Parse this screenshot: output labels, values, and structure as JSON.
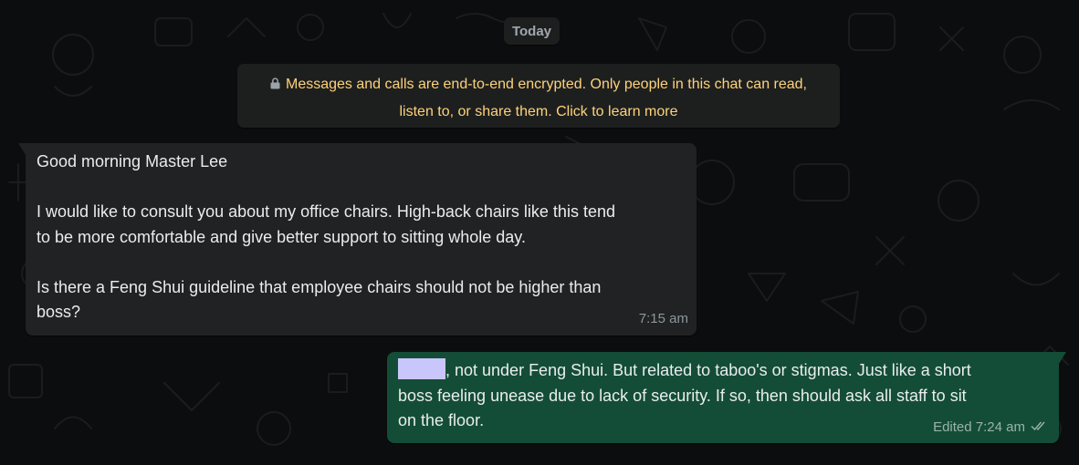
{
  "date_divider": "Today",
  "encryption_notice": {
    "line1": "Messages and calls are end-to-end encrypted. Only people in this chat can read,",
    "line2": "listen to, or share them. Click to learn more",
    "icon": "lock-icon"
  },
  "messages": [
    {
      "direction": "incoming",
      "lines": [
        "Good morning Master Lee",
        "",
        "I would like to consult you about my office chairs. High-back chairs like this tend",
        "to be more comfortable and give better support to sitting whole day.",
        "",
        "Is there a Feng Shui guideline that employee chairs should not be higher than",
        "boss?"
      ],
      "time": "7:15 am"
    },
    {
      "direction": "outgoing",
      "redacted_prefix": true,
      "lines": [
        ", not under Feng Shui. But related to taboo's or stigmas. Just like a short",
        "boss feeling unease due to lack of security. If so, then should ask all staff to sit",
        "on the floor."
      ],
      "edited_label": "Edited",
      "time": "7:24 am",
      "status_icon": "double-check-icon"
    }
  ],
  "colors": {
    "background": "#0b0d0e",
    "incoming_bubble": "#202223",
    "outgoing_bubble": "#144d37",
    "notice_text": "#ffd279",
    "redaction": "#c9c6fb"
  }
}
